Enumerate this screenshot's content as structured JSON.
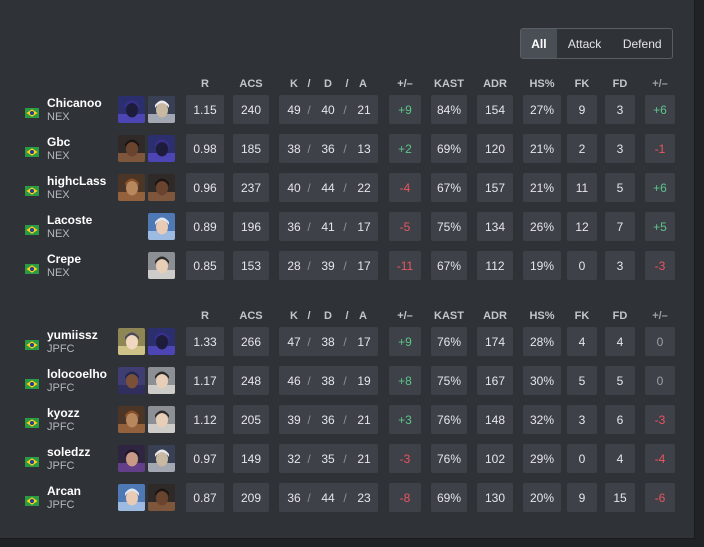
{
  "filter": {
    "options": [
      "All",
      "Attack",
      "Defend"
    ],
    "active": "All"
  },
  "columns": [
    "R",
    "ACS",
    "K",
    "/",
    "D",
    "/",
    "A",
    "+/–",
    "KAST",
    "ADR",
    "HS%",
    "FK",
    "FD",
    "+/–"
  ],
  "colors": {
    "positive": "#5dc48a",
    "negative": "#ea5460",
    "neutral": "#9aa0a8",
    "box": "#3e4248"
  },
  "teams": [
    {
      "players": [
        {
          "name": "Chicanoo",
          "team": "NEX",
          "flag": "brazil-flag",
          "agents": [
            "omen",
            "sova"
          ],
          "r": "1.15",
          "acs": "240",
          "k": "49",
          "d": "40",
          "a": "21",
          "pm": "+9",
          "pm_type": "pos",
          "kast": "84%",
          "adr": "154",
          "hs": "27%",
          "fk": "9",
          "fd": "3",
          "fkpm": "+6",
          "fkpm_type": "pos"
        },
        {
          "name": "Gbc",
          "team": "NEX",
          "flag": "brazil-flag",
          "agents": [
            "phoenix",
            "omen"
          ],
          "r": "0.98",
          "acs": "185",
          "k": "38",
          "d": "36",
          "a": "13",
          "pm": "+2",
          "pm_type": "pos",
          "kast": "69%",
          "adr": "120",
          "hs": "21%",
          "fk": "2",
          "fd": "3",
          "fkpm": "-1",
          "fkpm_type": "neg"
        },
        {
          "name": "highcLass",
          "team": "NEX",
          "flag": "brazil-flag",
          "agents": [
            "breach",
            "phoenix"
          ],
          "r": "0.96",
          "acs": "237",
          "k": "40",
          "d": "44",
          "a": "22",
          "pm": "-4",
          "pm_type": "neg",
          "kast": "67%",
          "adr": "157",
          "hs": "21%",
          "fk": "11",
          "fd": "5",
          "fkpm": "+6",
          "fkpm_type": "pos"
        },
        {
          "name": "Lacoste",
          "team": "NEX",
          "flag": "brazil-flag",
          "agents": [
            "jett"
          ],
          "r": "0.89",
          "acs": "196",
          "k": "36",
          "d": "41",
          "a": "17",
          "pm": "-5",
          "pm_type": "neg",
          "kast": "75%",
          "adr": "134",
          "hs": "26%",
          "fk": "12",
          "fd": "7",
          "fkpm": "+5",
          "fkpm_type": "pos"
        },
        {
          "name": "Crepe",
          "team": "NEX",
          "flag": "brazil-flag",
          "agents": [
            "sage"
          ],
          "r": "0.85",
          "acs": "153",
          "k": "28",
          "d": "39",
          "a": "17",
          "pm": "-11",
          "pm_type": "neg",
          "kast": "67%",
          "adr": "112",
          "hs": "19%",
          "fk": "0",
          "fd": "3",
          "fkpm": "-3",
          "fkpm_type": "neg"
        }
      ]
    },
    {
      "players": [
        {
          "name": "yumiissz",
          "team": "JPFC",
          "flag": "brazil-flag",
          "agents": [
            "killjoy",
            "omen"
          ],
          "r": "1.33",
          "acs": "266",
          "k": "47",
          "d": "38",
          "a": "17",
          "pm": "+9",
          "pm_type": "pos",
          "kast": "76%",
          "adr": "174",
          "hs": "28%",
          "fk": "4",
          "fd": "4",
          "fkpm": "0",
          "fkpm_type": "neu"
        },
        {
          "name": "lolocoelho",
          "team": "JPFC",
          "flag": "brazil-flag",
          "agents": [
            "neon",
            "sage"
          ],
          "r": "1.17",
          "acs": "248",
          "k": "46",
          "d": "38",
          "a": "19",
          "pm": "+8",
          "pm_type": "pos",
          "kast": "75%",
          "adr": "167",
          "hs": "30%",
          "fk": "5",
          "fd": "5",
          "fkpm": "0",
          "fkpm_type": "neu"
        },
        {
          "name": "kyozz",
          "team": "JPFC",
          "flag": "brazil-flag",
          "agents": [
            "breach",
            "sage"
          ],
          "r": "1.12",
          "acs": "205",
          "k": "39",
          "d": "36",
          "a": "21",
          "pm": "+3",
          "pm_type": "pos",
          "kast": "76%",
          "adr": "148",
          "hs": "32%",
          "fk": "3",
          "fd": "6",
          "fkpm": "-3",
          "fkpm_type": "neg"
        },
        {
          "name": "soledzz",
          "team": "JPFC",
          "flag": "brazil-flag",
          "agents": [
            "reyna",
            "sova"
          ],
          "r": "0.97",
          "acs": "149",
          "k": "32",
          "d": "35",
          "a": "21",
          "pm": "-3",
          "pm_type": "neg",
          "kast": "76%",
          "adr": "102",
          "hs": "29%",
          "fk": "0",
          "fd": "4",
          "fkpm": "-4",
          "fkpm_type": "neg"
        },
        {
          "name": "Arcan",
          "team": "JPFC",
          "flag": "brazil-flag",
          "agents": [
            "jett",
            "phoenix"
          ],
          "r": "0.87",
          "acs": "209",
          "k": "36",
          "d": "44",
          "a": "23",
          "pm": "-8",
          "pm_type": "neg",
          "kast": "69%",
          "adr": "130",
          "hs": "20%",
          "fk": "9",
          "fd": "15",
          "fkpm": "-6",
          "fkpm_type": "neg"
        }
      ]
    }
  ]
}
